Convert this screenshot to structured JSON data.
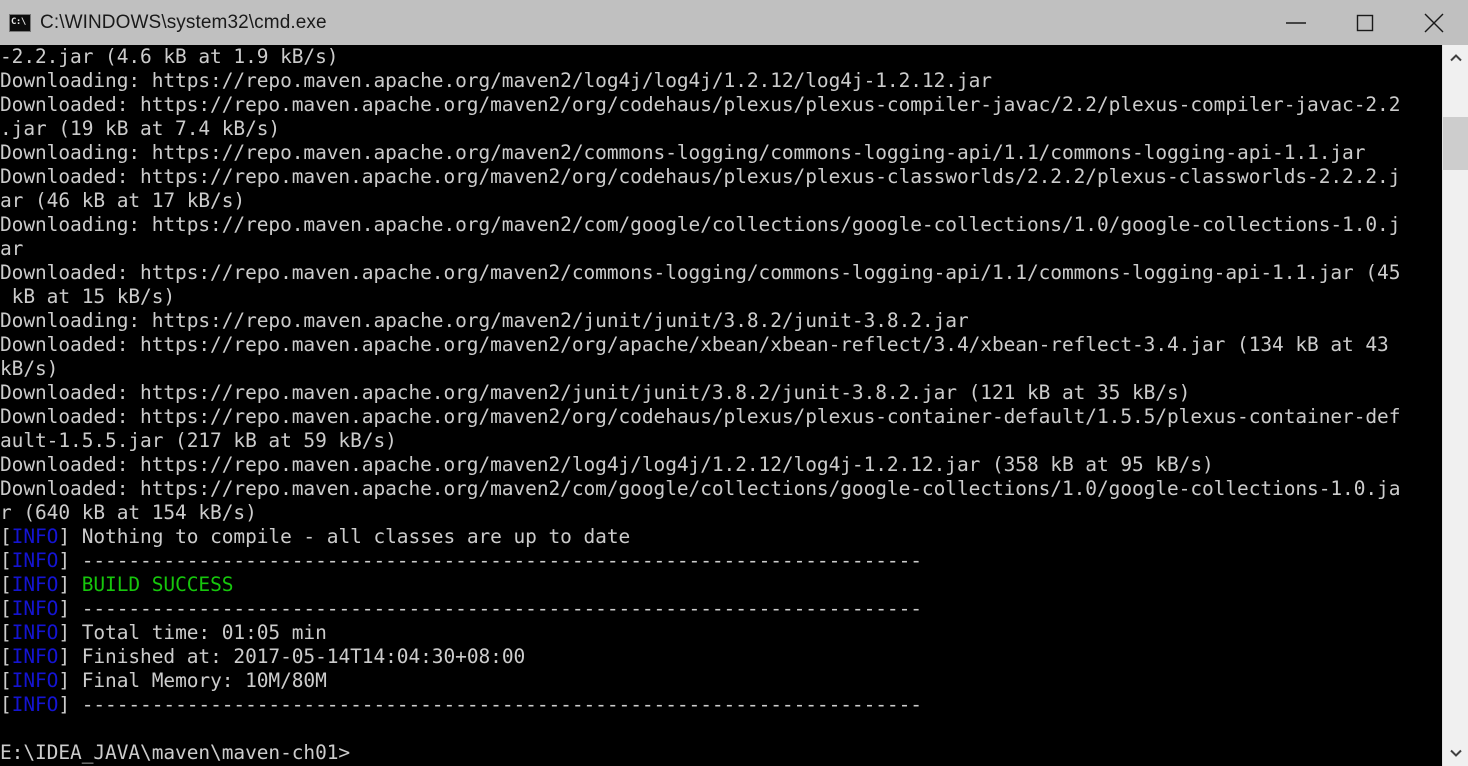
{
  "window": {
    "title": "C:\\WINDOWS\\system32\\cmd.exe",
    "icon_label": "C:\\",
    "icon_name": "cmd-console-icon",
    "background_color": "#000000",
    "titlebar_color": "#c0c0c0",
    "controls": {
      "minimize_label": "Minimize",
      "maximize_label": "Maximize",
      "close_label": "Close"
    }
  },
  "colors": {
    "text": "#cccccc",
    "info_tag": "#1414d2",
    "success": "#16c60c",
    "titlebar": "#c0c0c0",
    "scrollbar_track": "#f0f0f0",
    "scrollbar_thumb": "#cdcdcd"
  },
  "scrollbar": {
    "up_arrow": "scroll-up-arrow-icon",
    "down_arrow": "scroll-down-arrow-icon",
    "thumb_position_percent": 7
  },
  "console": {
    "prompt": "E:\\IDEA_JAVA\\maven\\maven-ch01>",
    "lines": [
      {
        "type": "plain",
        "text": "-2.2.jar (4.6 kB at 1.9 kB/s)"
      },
      {
        "type": "plain",
        "text": "Downloading: https://repo.maven.apache.org/maven2/log4j/log4j/1.2.12/log4j-1.2.12.jar"
      },
      {
        "type": "plain",
        "text": "Downloaded: https://repo.maven.apache.org/maven2/org/codehaus/plexus/plexus-compiler-javac/2.2/plexus-compiler-javac-2.2"
      },
      {
        "type": "plain",
        "text": ".jar (19 kB at 7.4 kB/s)"
      },
      {
        "type": "plain",
        "text": "Downloading: https://repo.maven.apache.org/maven2/commons-logging/commons-logging-api/1.1/commons-logging-api-1.1.jar"
      },
      {
        "type": "plain",
        "text": "Downloaded: https://repo.maven.apache.org/maven2/org/codehaus/plexus/plexus-classworlds/2.2.2/plexus-classworlds-2.2.2.j"
      },
      {
        "type": "plain",
        "text": "ar (46 kB at 17 kB/s)"
      },
      {
        "type": "plain",
        "text": "Downloading: https://repo.maven.apache.org/maven2/com/google/collections/google-collections/1.0/google-collections-1.0.j"
      },
      {
        "type": "plain",
        "text": "ar"
      },
      {
        "type": "plain",
        "text": "Downloaded: https://repo.maven.apache.org/maven2/commons-logging/commons-logging-api/1.1/commons-logging-api-1.1.jar (45"
      },
      {
        "type": "plain",
        "text": " kB at 15 kB/s)"
      },
      {
        "type": "plain",
        "text": "Downloading: https://repo.maven.apache.org/maven2/junit/junit/3.8.2/junit-3.8.2.jar"
      },
      {
        "type": "plain",
        "text": "Downloaded: https://repo.maven.apache.org/maven2/org/apache/xbean/xbean-reflect/3.4/xbean-reflect-3.4.jar (134 kB at 43"
      },
      {
        "type": "plain",
        "text": "kB/s)"
      },
      {
        "type": "plain",
        "text": "Downloaded: https://repo.maven.apache.org/maven2/junit/junit/3.8.2/junit-3.8.2.jar (121 kB at 35 kB/s)"
      },
      {
        "type": "plain",
        "text": "Downloaded: https://repo.maven.apache.org/maven2/org/codehaus/plexus/plexus-container-default/1.5.5/plexus-container-def"
      },
      {
        "type": "plain",
        "text": "ault-1.5.5.jar (217 kB at 59 kB/s)"
      },
      {
        "type": "plain",
        "text": "Downloaded: https://repo.maven.apache.org/maven2/log4j/log4j/1.2.12/log4j-1.2.12.jar (358 kB at 95 kB/s)"
      },
      {
        "type": "plain",
        "text": "Downloaded: https://repo.maven.apache.org/maven2/com/google/collections/google-collections/1.0/google-collections-1.0.ja"
      },
      {
        "type": "plain",
        "text": "r (640 kB at 154 kB/s)"
      },
      {
        "type": "info",
        "tag": "INFO",
        "text": "Nothing to compile - all classes are up to date"
      },
      {
        "type": "info",
        "tag": "INFO",
        "text": "------------------------------------------------------------------------"
      },
      {
        "type": "info-success",
        "tag": "INFO",
        "text": "BUILD SUCCESS"
      },
      {
        "type": "info",
        "tag": "INFO",
        "text": "------------------------------------------------------------------------"
      },
      {
        "type": "info",
        "tag": "INFO",
        "text": "Total time: 01:05 min"
      },
      {
        "type": "info",
        "tag": "INFO",
        "text": "Finished at: 2017-05-14T14:04:30+08:00"
      },
      {
        "type": "info",
        "tag": "INFO",
        "text": "Final Memory: 10M/80M"
      },
      {
        "type": "info",
        "tag": "INFO",
        "text": "------------------------------------------------------------------------"
      },
      {
        "type": "blank",
        "text": ""
      },
      {
        "type": "prompt",
        "text": "E:\\IDEA_JAVA\\maven\\maven-ch01>"
      }
    ]
  }
}
